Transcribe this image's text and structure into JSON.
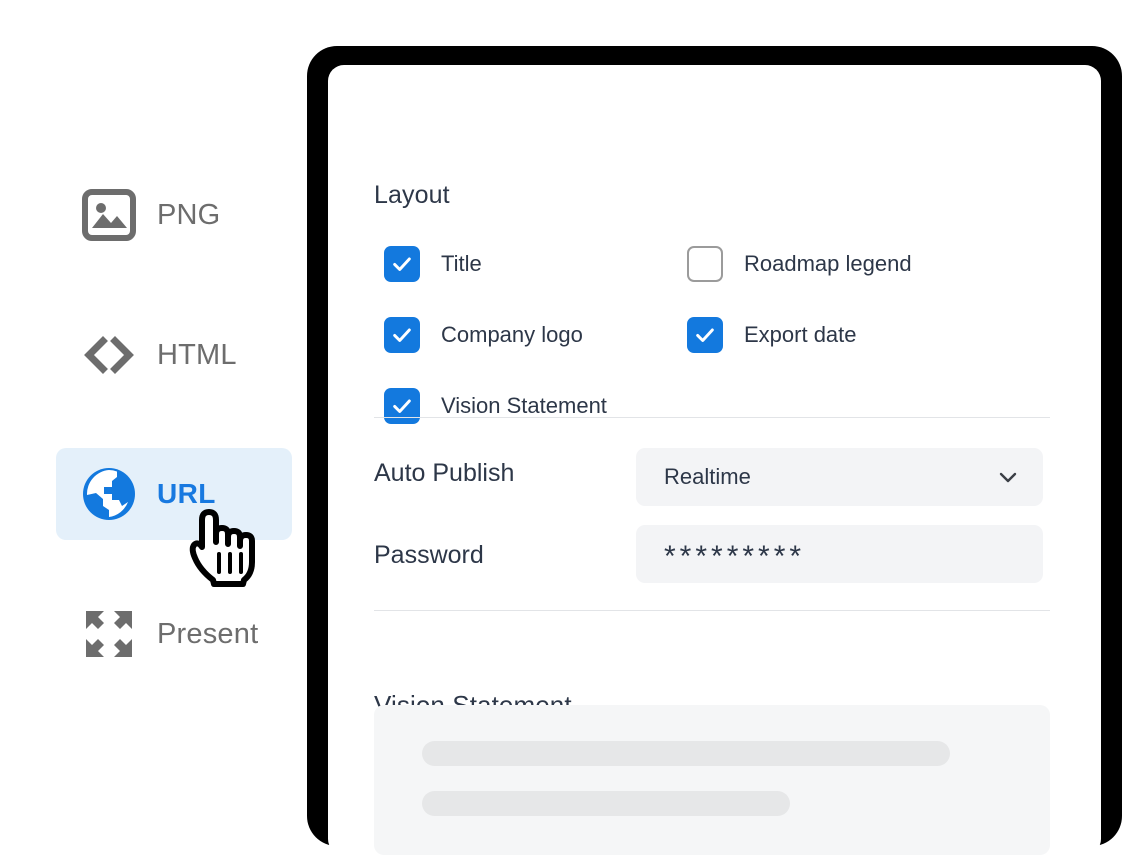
{
  "export_options": [
    {
      "id": "png",
      "label": "PNG",
      "icon": "image-icon",
      "selected": false
    },
    {
      "id": "html",
      "label": "HTML",
      "icon": "code-icon",
      "selected": false
    },
    {
      "id": "url",
      "label": "URL",
      "icon": "globe-icon",
      "selected": true
    },
    {
      "id": "present",
      "label": "Present",
      "icon": "fullscreen-icon",
      "selected": false
    }
  ],
  "cursor": {
    "type": "pointing-hand-cursor"
  },
  "panel": {
    "layout": {
      "title": "Layout",
      "checkboxes": [
        {
          "label": "Title",
          "checked": true
        },
        {
          "label": "Company logo",
          "checked": true
        },
        {
          "label": "Vision Statement",
          "checked": true
        },
        {
          "label": "Roadmap legend",
          "checked": false
        },
        {
          "label": "Export date",
          "checked": true
        }
      ]
    },
    "auto_publish": {
      "label": "Auto Publish",
      "value": "Realtime",
      "chevron": "chevron-down-icon"
    },
    "password": {
      "label": "Password",
      "value": "*********"
    },
    "vision_statement": {
      "title": "Vision Statement",
      "placeholder_lines": 2
    }
  },
  "colors": {
    "accent": "#1379de",
    "selected_background": "#e4f0fa",
    "selected_text": "#1879e0",
    "text_primary": "#2d3748",
    "text_muted": "#6d6d6d",
    "field_background": "#f3f4f6",
    "frame": "#000000"
  }
}
